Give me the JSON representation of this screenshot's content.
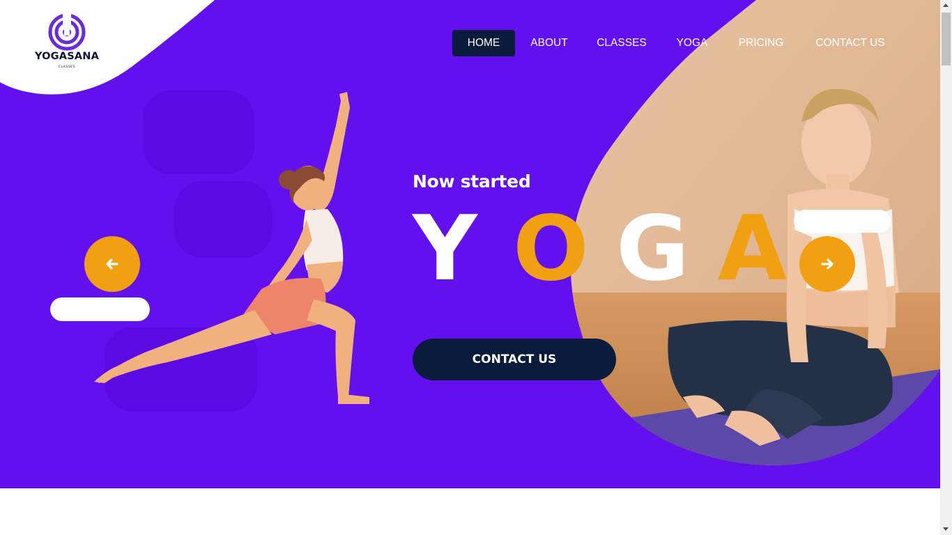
{
  "brand": {
    "name": "YOGASANA",
    "sub": "CLASSES"
  },
  "nav": {
    "items": [
      {
        "label": "HOME",
        "active": true
      },
      {
        "label": "ABOUT",
        "active": false
      },
      {
        "label": "CLASSES",
        "active": false
      },
      {
        "label": "YOGA",
        "active": false
      },
      {
        "label": "PRICING",
        "active": false
      },
      {
        "label": "CONTACT US",
        "active": false
      }
    ]
  },
  "hero": {
    "headline": "Now started",
    "word": [
      "Y",
      "O",
      "G",
      "A"
    ],
    "cta_label": "CONTACT US",
    "slider": {
      "prev_icon": "arrow-left-icon",
      "next_icon": "arrow-right-icon"
    }
  },
  "colors": {
    "primary": "#6210ee",
    "accent": "#f0a010",
    "dark": "#0a1b3c",
    "white": "#ffffff"
  }
}
